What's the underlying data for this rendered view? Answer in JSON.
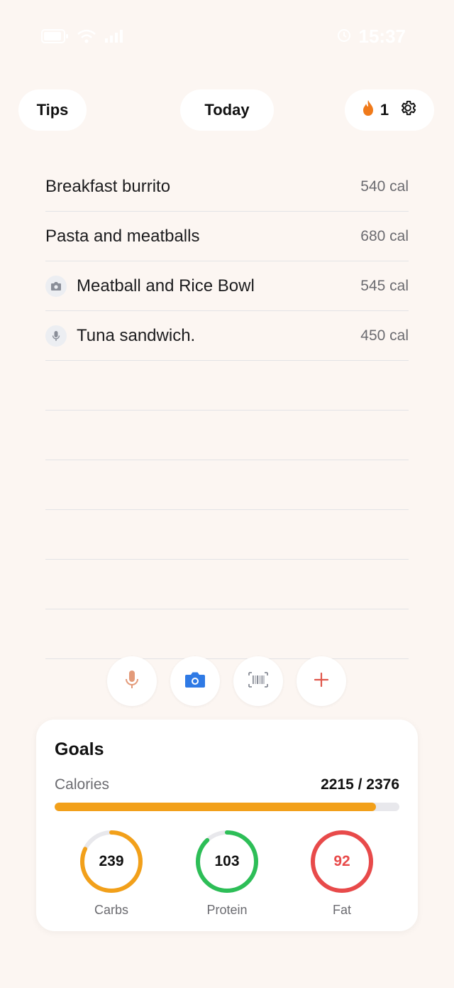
{
  "status_bar": {
    "time": "15:37"
  },
  "header": {
    "tips_label": "Tips",
    "today_label": "Today",
    "streak_count": "1"
  },
  "colors": {
    "accent_orange": "#f2a01a",
    "protein_green": "#2dbe57",
    "fat_red": "#e84a4a",
    "mic_orange": "#e39a79",
    "camera_blue": "#2f7ae5",
    "add_red": "#e0574b"
  },
  "food_items": [
    {
      "name": "Breakfast burrito",
      "calories": "540 cal",
      "icon": ""
    },
    {
      "name": "Pasta and meatballs",
      "calories": "680 cal",
      "icon": ""
    },
    {
      "name": "Meatball and Rice Bowl",
      "calories": "545 cal",
      "icon": "camera-icon"
    },
    {
      "name": "Tuna sandwich.",
      "calories": "450 cal",
      "icon": "microphone-icon"
    }
  ],
  "goals": {
    "title": "Goals",
    "calories_label": "Calories",
    "calories_value": "2215 / 2376",
    "calories_consumed": 2215,
    "calories_target": 2376,
    "macros": [
      {
        "label": "Carbs",
        "value": "239",
        "progress": 0.82
      },
      {
        "label": "Protein",
        "value": "103",
        "progress": 0.88
      },
      {
        "label": "Fat",
        "value": "92",
        "progress": 1.0
      }
    ]
  }
}
